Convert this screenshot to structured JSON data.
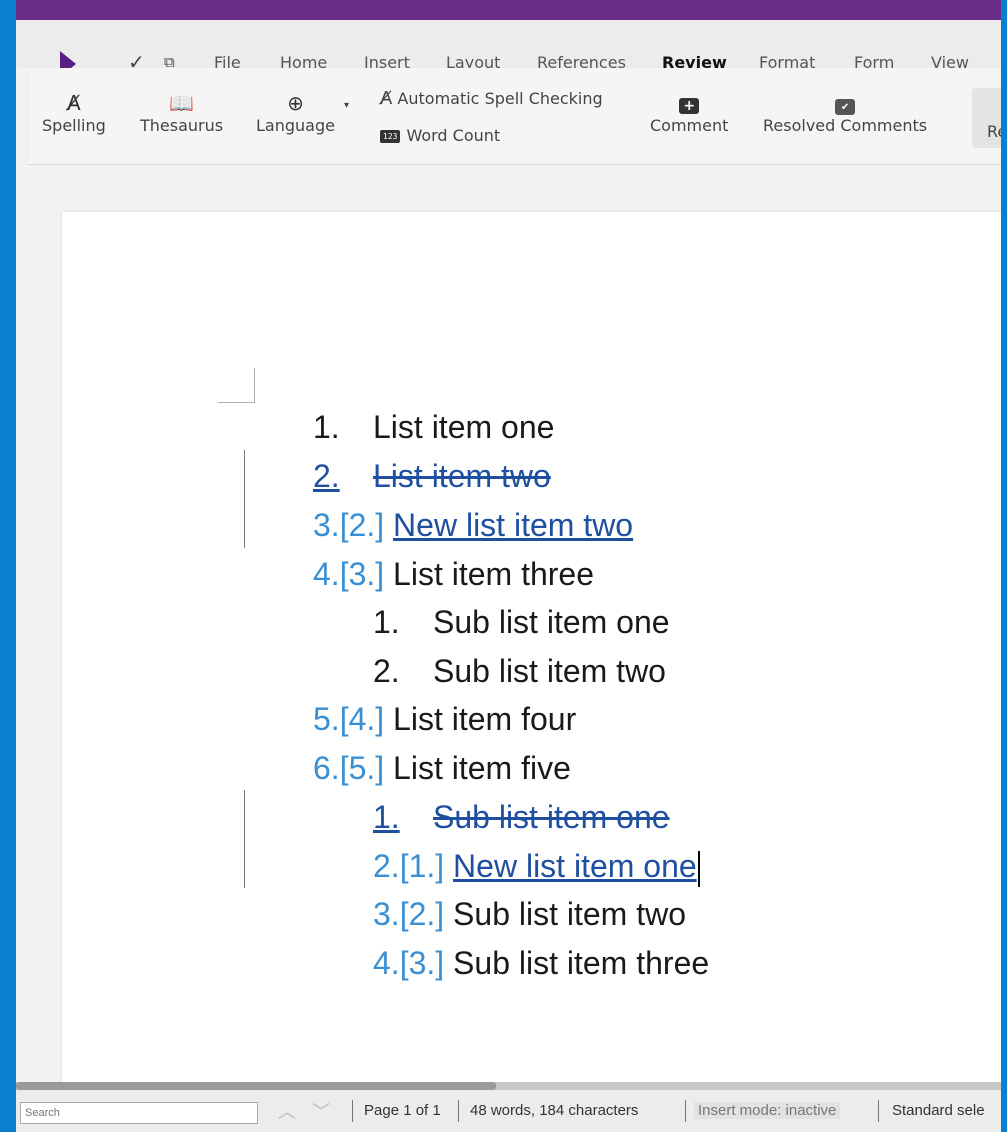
{
  "menubar": {
    "items": [
      "File",
      "Home",
      "Insert",
      "Layout",
      "References",
      "Review",
      "Format",
      "Form",
      "View"
    ],
    "active": "Review"
  },
  "ribbon": {
    "spelling": "Spelling",
    "thesaurus": "Thesaurus",
    "language": "Language",
    "auto_spell": "Automatic Spell Checking",
    "word_count_badge": "123",
    "word_count": "Word Count",
    "comment": "Comment",
    "resolved_comments": "Resolved Comments",
    "truncated": "Rec"
  },
  "document": {
    "items": [
      {
        "num": "1.",
        "text": "List item one"
      },
      {
        "num": "2.",
        "text": "List item two",
        "deleted": true
      },
      {
        "num": "3.",
        "old": "[2.]",
        "text": "New list item two",
        "inserted": true
      },
      {
        "num": "4.",
        "old": "[3.]",
        "text": "List item three"
      },
      {
        "num": "1.",
        "text": "Sub list item one",
        "level": 2
      },
      {
        "num": "2.",
        "text": "Sub list item two",
        "level": 2
      },
      {
        "num": "5.",
        "old": "[4.]",
        "text": "List item four"
      },
      {
        "num": "6.",
        "old": "[5.]",
        "text": "List item five"
      },
      {
        "num": "1.",
        "text": "Sub list item one",
        "level": 2,
        "deleted": true
      },
      {
        "num": "2.",
        "old": "[1.]",
        "text": "New list item one",
        "level": 2,
        "inserted": true
      },
      {
        "num": "3.",
        "old": "[2.]",
        "text": "Sub list item two",
        "level": 2
      },
      {
        "num": "4.",
        "old": "[3.]",
        "text": "Sub list item three",
        "level": 2
      }
    ]
  },
  "statusbar": {
    "search_placeholder": "Search",
    "page": "Page 1 of 1",
    "counts": "48 words, 184 characters",
    "insert_mode": "Insert mode: inactive",
    "selection": "Standard sele"
  },
  "colors": {
    "brand": "#6b2d8a",
    "change_blue": "#1f4fa0",
    "number_blue": "#3a8fd2",
    "window_border": "#0a7fcf"
  }
}
